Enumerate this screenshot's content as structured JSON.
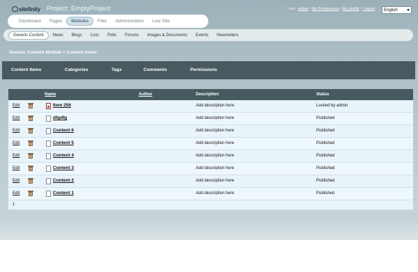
{
  "header": {
    "logo_text": "sitefinity",
    "project_title": "Project: EmptyProject",
    "user_label": "User:",
    "user_name": "admin",
    "my_preferences": "My Preferences",
    "my_profile": "My profile",
    "logout": "Logout",
    "language": "English"
  },
  "main_tabs": [
    {
      "label": "Dashboard"
    },
    {
      "label": "Pages"
    },
    {
      "label": "Modules",
      "active": true
    },
    {
      "label": "Files"
    },
    {
      "label": "Administration"
    },
    {
      "label": "Live Site"
    }
  ],
  "sub_tabs": [
    {
      "label": "Generic Content",
      "active": true
    },
    {
      "label": "News"
    },
    {
      "label": "Blogs"
    },
    {
      "label": "Lists"
    },
    {
      "label": "Polls"
    },
    {
      "label": "Forums"
    },
    {
      "label": "Images & Documents"
    },
    {
      "label": "Events"
    },
    {
      "label": "Newsletters"
    }
  ],
  "breadcrumb": "Generic Content Module > Content Items",
  "toolbar": [
    "Content Items",
    "Categories",
    "Tags",
    "Comments",
    "Permissions"
  ],
  "grid": {
    "columns": {
      "name": "Name",
      "author": "Author",
      "description": "Description",
      "status": "Status"
    },
    "rows": [
      {
        "edit": "Edit",
        "name": "Item 256",
        "author": "",
        "description": "Add description here",
        "status": "Locked by admin",
        "locked": true
      },
      {
        "edit": "Edit",
        "name": "dfgdfg",
        "author": "",
        "description": "Add description here",
        "status": "Published"
      },
      {
        "edit": "Edit",
        "name": "Content 6",
        "author": "",
        "description": "Add description here",
        "status": "Published"
      },
      {
        "edit": "Edit",
        "name": "Content 5",
        "author": "",
        "description": "Add description here",
        "status": "Published"
      },
      {
        "edit": "Edit",
        "name": "Content 4",
        "author": "",
        "description": "Add description here",
        "status": "Published"
      },
      {
        "edit": "Edit",
        "name": "Content 3",
        "author": "",
        "description": "Add description here",
        "status": "Published"
      },
      {
        "edit": "Edit",
        "name": "Content 2",
        "author": "",
        "description": "Add description here",
        "status": "Published"
      },
      {
        "edit": "Edit",
        "name": "Content 1",
        "author": "",
        "description": "Add description here",
        "status": "Published"
      }
    ],
    "page": "1"
  }
}
